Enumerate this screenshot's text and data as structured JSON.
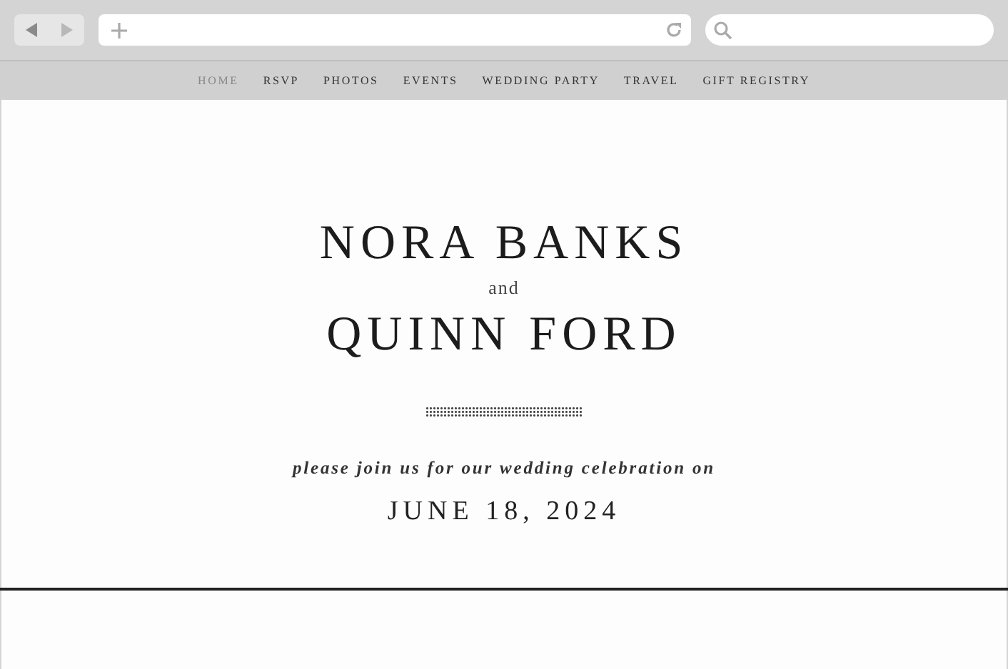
{
  "nav": [
    {
      "label": "HOME",
      "selected": true
    },
    {
      "label": "RSVP",
      "selected": false
    },
    {
      "label": "PHOTOS",
      "selected": false
    },
    {
      "label": "EVENTS",
      "selected": false
    },
    {
      "label": "WEDDING PARTY",
      "selected": false
    },
    {
      "label": "TRAVEL",
      "selected": false
    },
    {
      "label": "GIFT REGISTRY",
      "selected": false
    }
  ],
  "hero": {
    "name_1": "NORA BANKS",
    "joiner": "and",
    "name_2": "QUINN FORD",
    "invitation": "please join us for our wedding celebration on",
    "date": "JUNE 18, 2024"
  }
}
